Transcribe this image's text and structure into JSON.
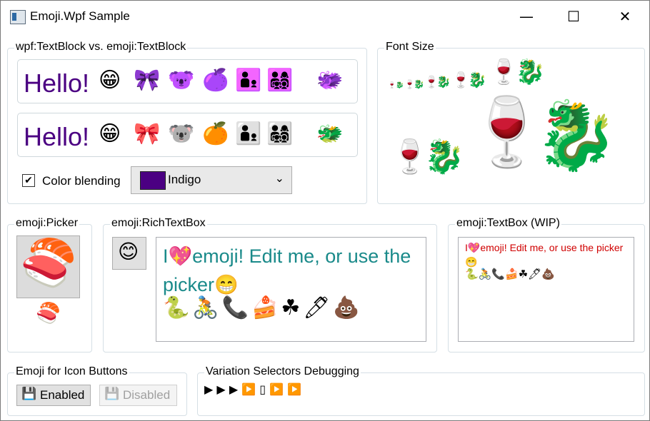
{
  "window": {
    "title": "Emoji.Wpf Sample",
    "minimize_glyph": "—",
    "maximize_glyph": "☐",
    "close_glyph": "✕"
  },
  "textblock_group": {
    "label": "wpf:TextBlock vs. emoji:TextBlock",
    "hello": "Hello!",
    "emojis": [
      "😁",
      "🎀",
      "🐨",
      "🍊",
      "👨‍👦",
      "👨‍👩‍👧‍👦",
      "🐲"
    ],
    "checkbox_label": "Color blending",
    "checkbox_checked": true,
    "checkbox_mark": "✔",
    "color_name": "Indigo",
    "color_value": "#4b0082",
    "dropdown_glyph": "⌄"
  },
  "font_size_group": {
    "label": "Font Size",
    "emojis": [
      "🍷",
      "🐉"
    ]
  },
  "picker_group": {
    "label": "emoji:Picker",
    "selected": "🍣"
  },
  "richtext_group": {
    "label": "emoji:RichTextBox",
    "button_emoji": "😊",
    "text_prefix": "I",
    "heart": "💖",
    "text_main": "emoji! Edit me, or use the picker",
    "text_end_emoji": "😁",
    "emoji_line": "🐍🚴📞🍰☘🖊💩",
    "text_color": "#1a8a8a"
  },
  "textbox_group": {
    "label": "emoji:TextBox (WIP)",
    "text_prefix": "I",
    "heart": "💖",
    "text_main": "emoji! Edit me, or use the picker",
    "text_end_emoji": "😁",
    "emoji_line": "🐍🚴📞🍰☘🖊💩",
    "text_color": "#d00000"
  },
  "icon_buttons_group": {
    "label": "Emoji for Icon Buttons",
    "icon": "💾",
    "enabled_label": "Enabled",
    "disabled_label": "Disabled"
  },
  "variation_group": {
    "label": "Variation Selectors Debugging",
    "sequence": [
      "▶",
      "▶",
      "▶",
      "▶️",
      "▯",
      "▶️",
      "▶️"
    ]
  }
}
